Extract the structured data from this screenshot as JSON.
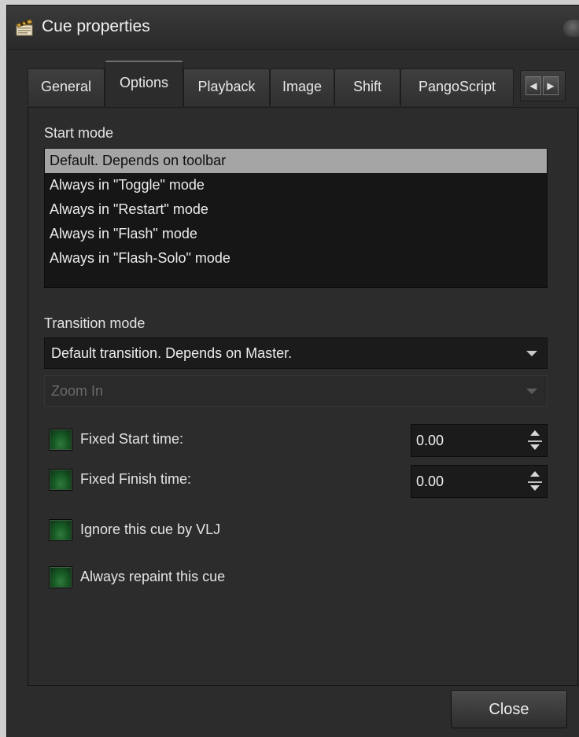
{
  "window": {
    "title": "Cue properties"
  },
  "tabs": [
    {
      "label": "General"
    },
    {
      "label": "Options"
    },
    {
      "label": "Playback"
    },
    {
      "label": "Image"
    },
    {
      "label": "Shift"
    },
    {
      "label": "PangoScript"
    }
  ],
  "active_tab": "Options",
  "start_mode": {
    "label": "Start mode",
    "items": [
      "Default. Depends on toolbar",
      "Always in \"Toggle\" mode",
      "Always in \"Restart\" mode",
      "Always in \"Flash\" mode",
      "Always in \"Flash-Solo\" mode"
    ],
    "selected": "Default. Depends on toolbar"
  },
  "transition_mode": {
    "label": "Transition mode",
    "value": "Default transition. Depends on Master.",
    "secondary_value": "Zoom In",
    "secondary_enabled": false
  },
  "checks": {
    "fixed_start": {
      "label": "Fixed Start time:",
      "value": "0.00"
    },
    "fixed_finish": {
      "label": "Fixed Finish time:",
      "value": "0.00"
    },
    "ignore_vlj": {
      "label": "Ignore this cue by VLJ"
    },
    "always_repaint": {
      "label": "Always repaint this cue"
    }
  },
  "buttons": {
    "close": "Close"
  },
  "colors": {
    "background": "#2c2c2c",
    "selection": "#a5a5a5",
    "checkbox_green": "#175a24"
  }
}
